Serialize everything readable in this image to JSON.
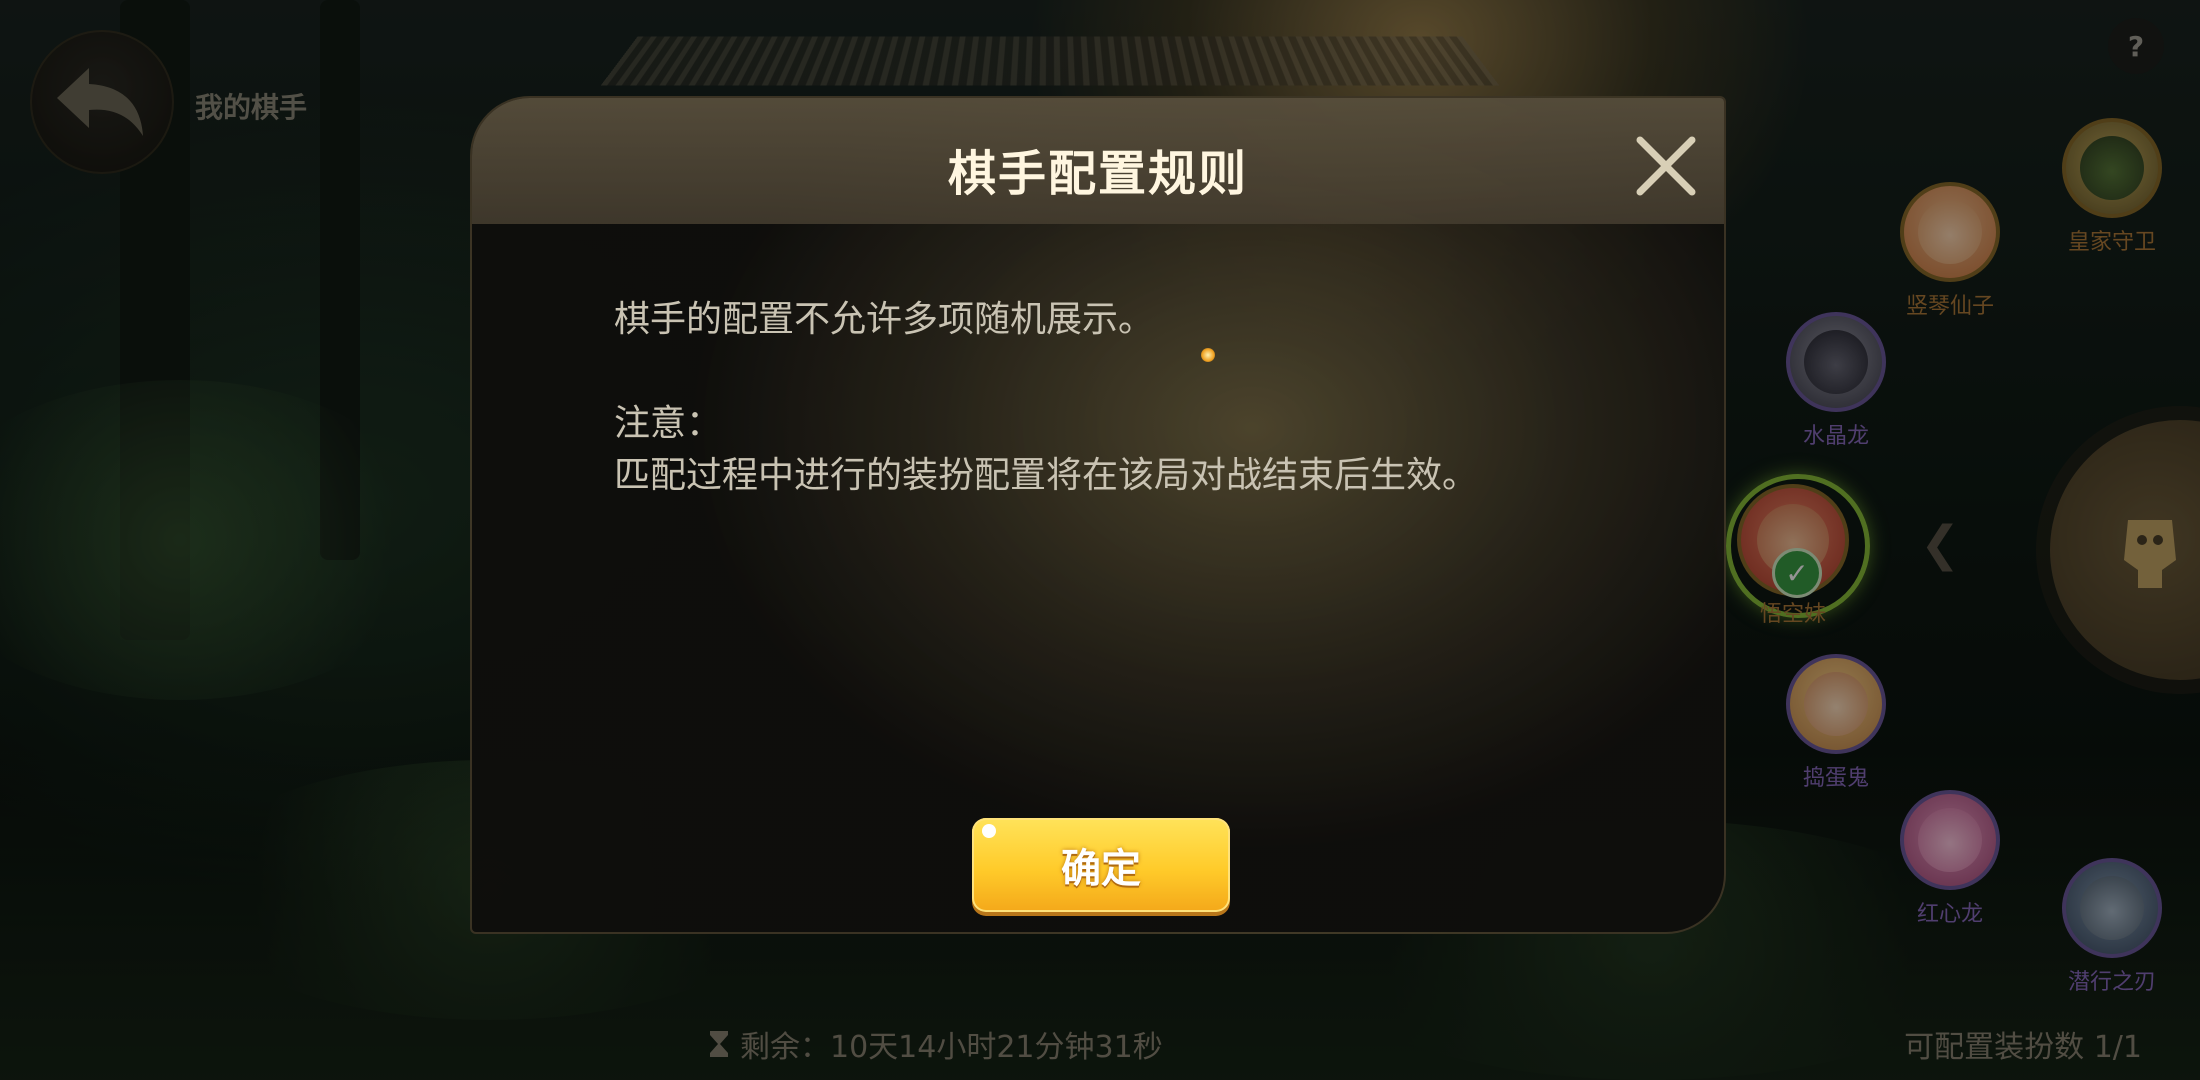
{
  "header": {
    "page_title": "我的棋手",
    "help": "?"
  },
  "dialog": {
    "title": "棋手配置规则",
    "body_line1": "棋手的配置不允许多项随机展示。",
    "note_label": "注意：",
    "note_text": "匹配过程中进行的装扮配置将在该局对战结束后生效。",
    "confirm_label": "确定"
  },
  "characters": [
    {
      "name": "皇家守卫",
      "rarity": "gold"
    },
    {
      "name": "竖琴仙子",
      "rarity": "gold"
    },
    {
      "name": "水晶龙",
      "rarity": "purple"
    },
    {
      "name": "悟空妹",
      "rarity": "gold",
      "selected": true
    },
    {
      "name": "捣蛋鬼",
      "rarity": "purple"
    },
    {
      "name": "红心龙",
      "rarity": "purple"
    },
    {
      "name": "潜行之刃",
      "rarity": "purple"
    }
  ],
  "footer": {
    "remaining": "剩余：10天14小时21分钟31秒",
    "config_count": "可配置装扮数 1/1"
  },
  "icons": {
    "back": "back-arrow-icon",
    "close": "close-icon",
    "timer": "hourglass-icon",
    "check": "check-icon"
  },
  "colors": {
    "accent_gold": "#ffcb2a",
    "purple_name": "#8a6bc0",
    "gold_name": "#b07a3a"
  }
}
